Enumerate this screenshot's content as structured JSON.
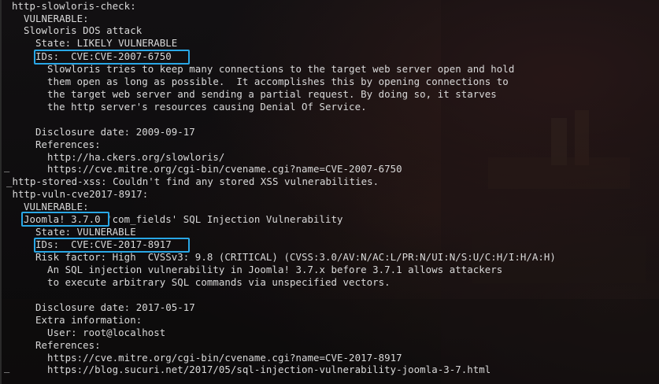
{
  "terminal": {
    "lines": [
      "http-slowloris-check:",
      "  VULNERABLE:",
      "  Slowloris DOS attack",
      "    State: LIKELY VULNERABLE",
      "    IDs:  CVE:CVE-2007-6750",
      "      Slowloris tries to keep many connections to the target web server open and hold",
      "      them open as long as possible.  It accomplishes this by opening connections to",
      "      the target web server and sending a partial request. By doing so, it starves",
      "      the http server's resources causing Denial Of Service.",
      "",
      "    Disclosure date: 2009-09-17",
      "    References:",
      "      http://ha.ckers.org/slowloris/",
      "      https://cve.mitre.org/cgi-bin/cvename.cgi?name=CVE-2007-6750",
      "_http-stored-xss: Couldn't find any stored XSS vulnerabilities.",
      " http-vuln-cve2017-8917:",
      "  VULNERABLE:",
      "  Joomla! 3.7.0 'com_fields' SQL Injection Vulnerability",
      "    State: VULNERABLE",
      "    IDs:  CVE:CVE-2017-8917",
      "    Risk factor: High  CVSSv3: 9.8 (CRITICAL) (CVSS:3.0/AV:N/AC:L/PR:N/UI:N/S:U/C:H/I:H/A:H)",
      "      An SQL injection vulnerability in Joomla! 3.7.x before 3.7.1 allows attackers",
      "      to execute arbitrary SQL commands via unspecified vectors.",
      "",
      "    Disclosure date: 2017-05-17",
      "    Extra information:",
      "      User: root@localhost",
      "    References:",
      "      https://cve.mitre.org/cgi-bin/cvename.cgi?name=CVE-2017-8917",
      "      https://blog.sucuri.net/2017/05/sql-injection-vulnerability-joomla-3-7.html"
    ],
    "gutter_marks": [
      "_",
      "_"
    ]
  },
  "colors": {
    "text": "#d9d9d9",
    "highlight": "#29a7e6",
    "background": "#0d0b0c"
  }
}
